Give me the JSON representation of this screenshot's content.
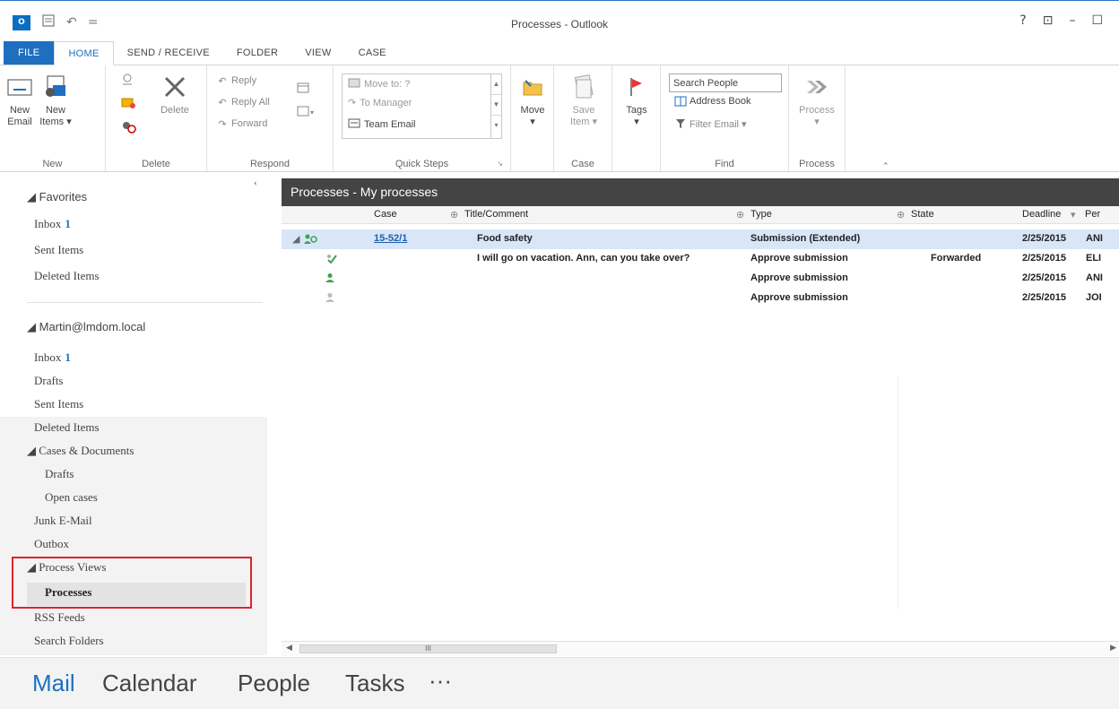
{
  "window": {
    "title": "Processes - Outlook",
    "help": "?",
    "ribbon_display": "⊡",
    "minimize": "–",
    "maximize": "☐",
    "logo_text": "O",
    "qat_undo": "↶",
    "qat_more": "="
  },
  "tabs": [
    "FILE",
    "HOME",
    "SEND / RECEIVE",
    "FOLDER",
    "VIEW",
    "CASE"
  ],
  "ribbon": {
    "new_email_line1": "New",
    "new_email_line2": "Email",
    "new_items_line1": "New",
    "new_items_line2": "Items ▾",
    "delete_label": "Delete",
    "reply": "Reply",
    "reply_all": "Reply All",
    "forward": "Forward",
    "move_to": "Move to: ?",
    "to_manager": "To Manager",
    "team_email": "Team Email",
    "move_label": "Move",
    "save_item_line1": "Save",
    "save_item_line2": "Item ▾",
    "tags_label": "Tags",
    "search_people": "Search People",
    "address_book": "Address Book",
    "filter_email": "Filter Email ▾",
    "process_label": "Process",
    "groups": {
      "new": "New",
      "delete": "Delete",
      "respond": "Respond",
      "quick_steps": "Quick Steps",
      "case": "Case",
      "find": "Find",
      "process": "Process"
    }
  },
  "nav": {
    "favorites_header": "◢ Favorites",
    "favorites": [
      {
        "label": "Inbox",
        "count": "1"
      },
      {
        "label": "Sent Items",
        "count": ""
      },
      {
        "label": "Deleted Items",
        "count": ""
      }
    ],
    "account_header": "◢ Martin@lmdom.local",
    "account_items": {
      "inbox": "Inbox",
      "inbox_count": "1",
      "drafts": "Drafts",
      "sent": "Sent Items",
      "deleted": "Deleted Items",
      "cases_header": "◢ Cases & Documents",
      "cases_drafts": "Drafts",
      "open_cases": "Open cases",
      "junk": "Junk E-Mail",
      "outbox": "Outbox",
      "process_views_header": "◢ Process Views",
      "processes": "Processes",
      "rss": "RSS Feeds",
      "search_folders": "Search Folders"
    }
  },
  "main": {
    "header": "Processes - My processes",
    "columns": {
      "case": "Case",
      "title": "Title/Comment",
      "type": "Type",
      "state": "State",
      "deadline": "Deadline",
      "person": "Per"
    },
    "rows": [
      {
        "case": "15-52/1",
        "title": "Food safety",
        "type": "Submission (Extended)",
        "state": "",
        "deadline": "2/25/2015",
        "person": "ANI"
      },
      {
        "case": "",
        "title": "I will go on vacation. Ann, can you take over?",
        "type": "Approve submission",
        "state": "Forwarded",
        "deadline": "2/25/2015",
        "person": "ELI"
      },
      {
        "case": "",
        "title": "",
        "type": "Approve submission",
        "state": "",
        "deadline": "2/25/2015",
        "person": "ANI"
      },
      {
        "case": "",
        "title": "",
        "type": "Approve submission",
        "state": "",
        "deadline": "2/25/2015",
        "person": "JOI"
      }
    ],
    "scroll_thumb": "III"
  },
  "bottomnav": [
    "Mail",
    "Calendar",
    "People",
    "Tasks",
    "···"
  ],
  "colors": {
    "accent": "#1e6fc0",
    "header_dark": "#444444",
    "highlight_box": "#e1222a",
    "selected_row": "#d8e6f8"
  }
}
